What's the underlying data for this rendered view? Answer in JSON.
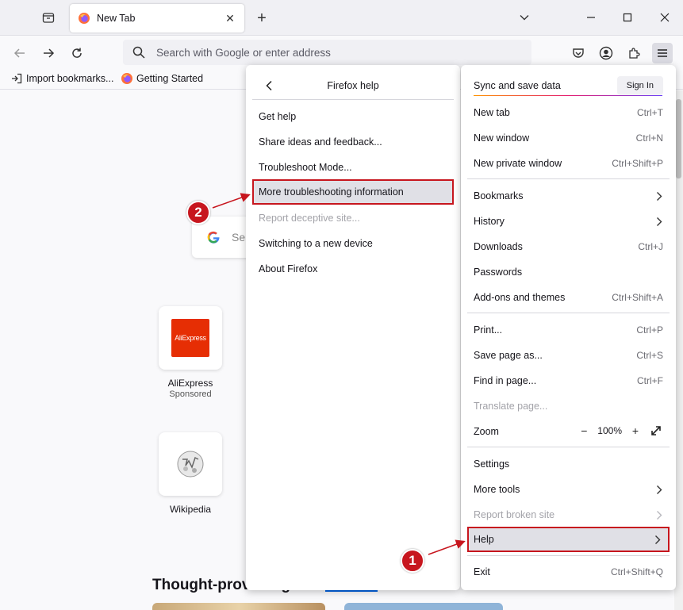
{
  "tabs": [
    {
      "title": "New Tab",
      "close": "✕"
    }
  ],
  "new_tab_symbol": "+",
  "address_bar": {
    "placeholder": "Search with Google or enter address"
  },
  "bookmarks": [
    {
      "label": "Import bookmarks...",
      "icon": "import-icon"
    },
    {
      "label": "Getting Started",
      "icon": "firefox-icon"
    }
  ],
  "newtab_page": {
    "search_partial": "Se",
    "shortcuts": [
      {
        "label": "AliExpress",
        "sub": "Sponsored",
        "tile_text": "AliExpress"
      },
      {
        "label": "Wikipedia",
        "sub": ""
      }
    ],
    "stories_heading": "Thought-provoking"
  },
  "help_panel": {
    "title": "Firefox help",
    "items": [
      {
        "label": "Get help",
        "disabled": false
      },
      {
        "label": "Share ideas and feedback...",
        "disabled": false
      },
      {
        "label": "Troubleshoot Mode...",
        "disabled": false
      },
      {
        "label": "More troubleshooting information",
        "disabled": false,
        "highlighted": true
      },
      {
        "label": "Report deceptive site...",
        "disabled": true
      },
      {
        "label": "Switching to a new device",
        "disabled": false
      },
      {
        "label": "About Firefox",
        "disabled": false
      }
    ]
  },
  "main_menu": {
    "sync_label": "Sync and save data",
    "sign_in": "Sign In",
    "items": [
      {
        "label": "New tab",
        "shortcut": "Ctrl+T"
      },
      {
        "label": "New window",
        "shortcut": "Ctrl+N"
      },
      {
        "label": "New private window",
        "shortcut": "Ctrl+Shift+P"
      },
      {
        "label": "Bookmarks",
        "submenu": true
      },
      {
        "label": "History",
        "submenu": true
      },
      {
        "label": "Downloads",
        "shortcut": "Ctrl+J"
      },
      {
        "label": "Passwords"
      },
      {
        "label": "Add-ons and themes",
        "shortcut": "Ctrl+Shift+A"
      },
      {
        "label": "Print...",
        "shortcut": "Ctrl+P"
      },
      {
        "label": "Save page as...",
        "shortcut": "Ctrl+S"
      },
      {
        "label": "Find in page...",
        "shortcut": "Ctrl+F"
      },
      {
        "label": "Translate page...",
        "disabled": true
      },
      {
        "label": "Zoom",
        "zoom_value": "100%",
        "zoom_out": "−",
        "zoom_in": "+"
      },
      {
        "label": "Settings"
      },
      {
        "label": "More tools",
        "submenu": true
      },
      {
        "label": "Report broken site",
        "submenu": true,
        "disabled": true
      },
      {
        "label": "Help",
        "submenu": true,
        "highlighted": true
      },
      {
        "label": "Exit",
        "shortcut": "Ctrl+Shift+Q"
      }
    ]
  },
  "annotations": [
    {
      "number": "1",
      "target": "Help"
    },
    {
      "number": "2",
      "target": "More troubleshooting information"
    }
  ],
  "colors": {
    "highlight_border": "#c7161e",
    "badge": "#c7161e",
    "accent": "#0061e0"
  }
}
